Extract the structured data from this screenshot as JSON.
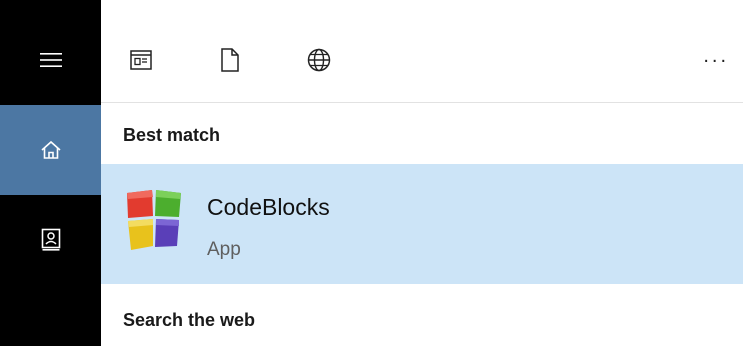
{
  "sidebar": {
    "items": [
      {
        "name": "menu",
        "icon": "hamburger-icon"
      },
      {
        "name": "home",
        "icon": "home-icon",
        "active": true
      },
      {
        "name": "notebook",
        "icon": "notebook-icon"
      }
    ]
  },
  "toolbar": {
    "icons": [
      "apps-icon",
      "documents-icon",
      "web-icon"
    ],
    "more_label": "..."
  },
  "best_match": {
    "label": "Best match",
    "result": {
      "title": "CodeBlocks",
      "type": "App",
      "icon": "codeblocks-app-icon"
    }
  },
  "search_web": {
    "label": "Search the web"
  },
  "colors": {
    "sidebar_bg": "#000000",
    "sidebar_active": "#4c77a3",
    "result_highlight": "#cce4f7"
  }
}
